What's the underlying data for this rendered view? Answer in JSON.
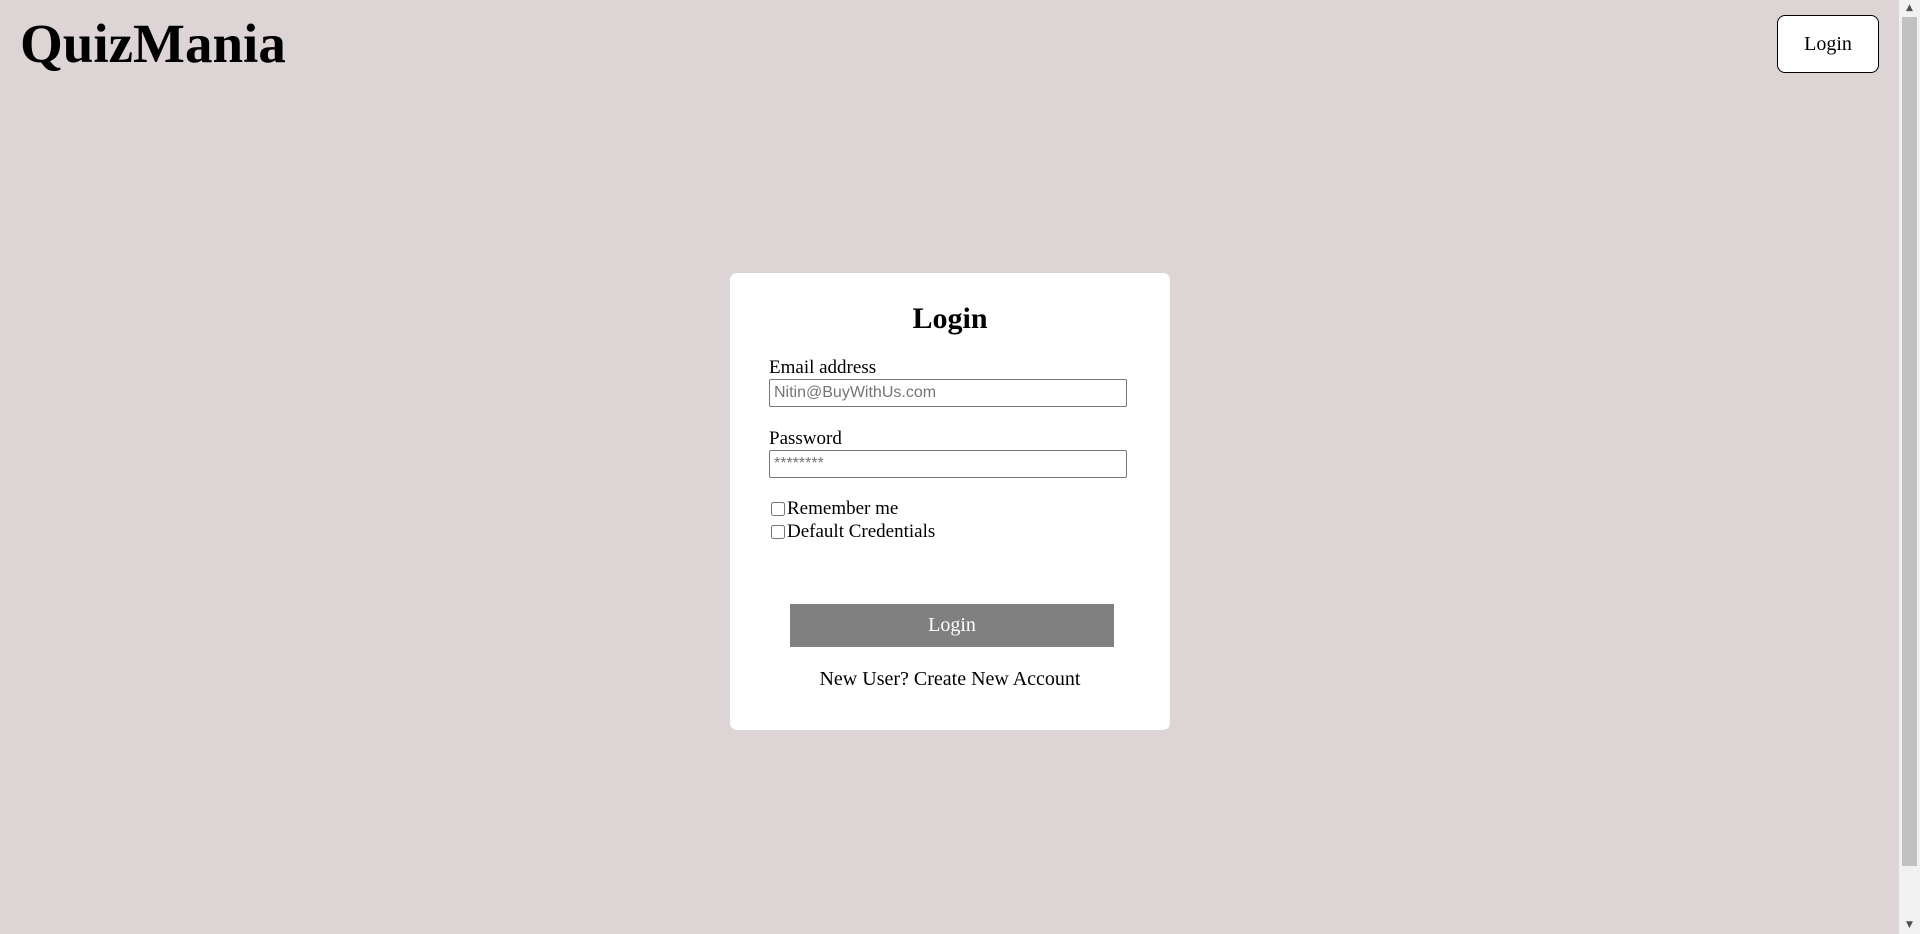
{
  "header": {
    "app_title": "QuizMania",
    "login_label": "Login"
  },
  "form": {
    "title": "Login",
    "email_label": "Email address",
    "email_placeholder": "Nitin@BuyWithUs.com",
    "email_value": "",
    "password_label": "Password",
    "password_placeholder": "********",
    "password_value": "",
    "remember_label": "Remember me",
    "remember_checked": false,
    "default_label": "Default Credentials",
    "default_checked": false,
    "submit_label": "Login",
    "signup_text": "New User? Create New Account"
  },
  "colors": {
    "background": "#ddd4d6",
    "card": "#ffffff",
    "submit_button": "#808080"
  }
}
